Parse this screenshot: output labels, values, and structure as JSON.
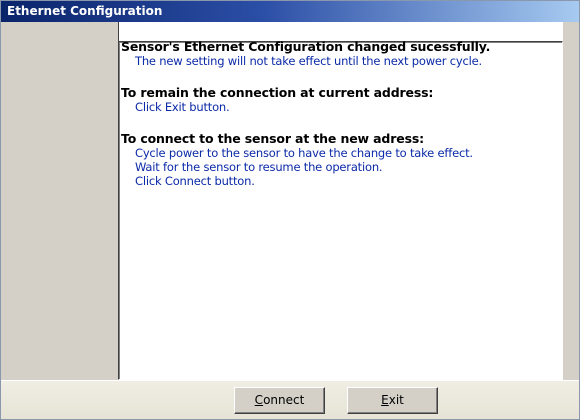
{
  "window": {
    "title": "Ethernet Configuration"
  },
  "message": {
    "heading_success": "Sensor's Ethernet Configuration changed sucessfully.",
    "note_power_cycle": "The new setting will not take effect until the next power cycle.",
    "heading_remain": "To remain the connection at current address:",
    "remain_step": "Click Exit button.",
    "heading_connect": "To connect to the sensor at the new adress:",
    "connect_steps": [
      "Cycle power to the sensor to have the change to take effect.",
      "Wait for the sensor to resume the operation.",
      "Click Connect button."
    ]
  },
  "buttons": {
    "connect_accel": "C",
    "connect_rest": "onnect",
    "exit_accel": "E",
    "exit_rest": "xit"
  },
  "colors": {
    "title_bar": "#0a246a",
    "instruction_text": "#0b2aa8",
    "heading_text": "#000000",
    "dialog_face": "#d4d0c8"
  }
}
